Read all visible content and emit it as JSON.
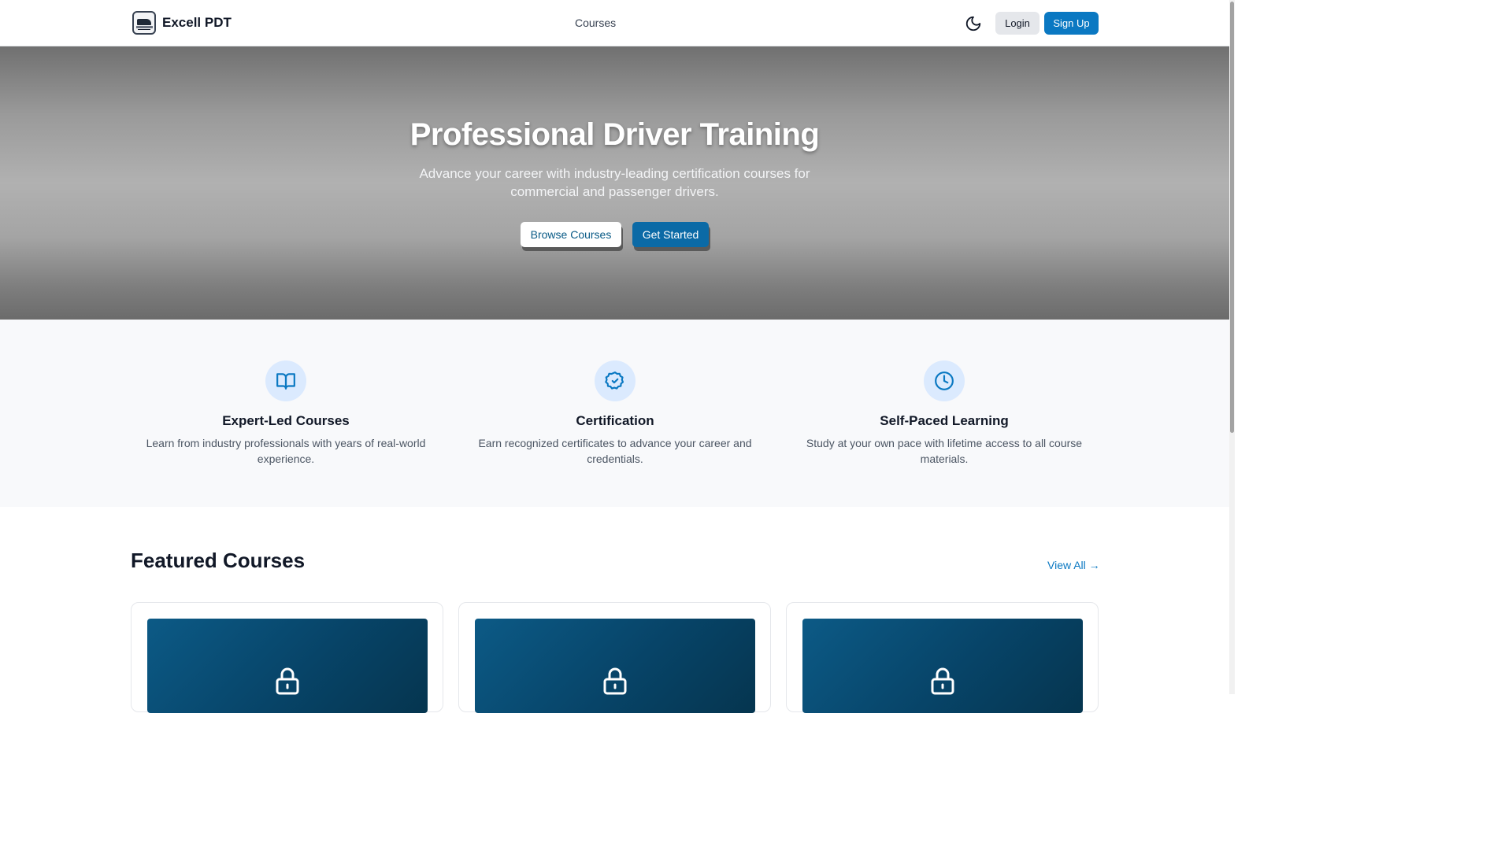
{
  "header": {
    "brand": "Excell PDT",
    "nav_courses": "Courses",
    "login_label": "Login",
    "signup_label": "Sign Up"
  },
  "hero": {
    "title": "Professional Driver Training",
    "subtitle": "Advance your career with industry-leading certification courses for commercial and passenger drivers.",
    "browse_label": "Browse Courses",
    "get_started_label": "Get Started"
  },
  "features": [
    {
      "title": "Expert-Led Courses",
      "description": "Learn from industry professionals with years of real-world experience.",
      "icon": "book-open-icon"
    },
    {
      "title": "Certification",
      "description": "Earn recognized certificates to advance your career and credentials.",
      "icon": "badge-check-icon"
    },
    {
      "title": "Self-Paced Learning",
      "description": "Study at your own pace with lifetime access to all course materials.",
      "icon": "clock-icon"
    }
  ],
  "featured": {
    "title": "Featured Courses",
    "view_all": "View All →"
  },
  "colors": {
    "accent": "#0a78c2",
    "card_thumb": "#074468",
    "icon_bg": "#dbeafe"
  }
}
